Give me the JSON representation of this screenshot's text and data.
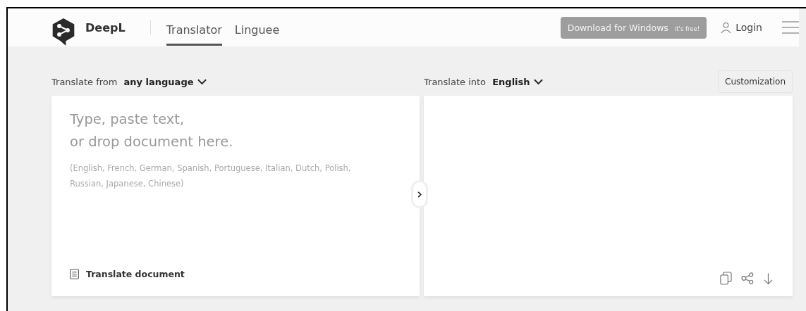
{
  "header": {
    "brand": "DeepL",
    "tabs": [
      {
        "label": "Translator",
        "selected": true
      },
      {
        "label": "Linguee",
        "selected": false
      }
    ],
    "download_button": {
      "label": "Download for Windows",
      "note": "it's free!"
    },
    "login": "Login"
  },
  "source": {
    "prefix": "Translate from",
    "language": "any language",
    "placeholder_lines": [
      "Type, paste text,",
      "or drop document here."
    ],
    "languages_hint": "(English, French, German, Spanish, Portuguese, Italian, Dutch, Polish, Russian, Japanese, Chinese)",
    "document_button": "Translate document"
  },
  "target": {
    "prefix": "Translate into",
    "language": "English",
    "customization_button": "Customization"
  }
}
